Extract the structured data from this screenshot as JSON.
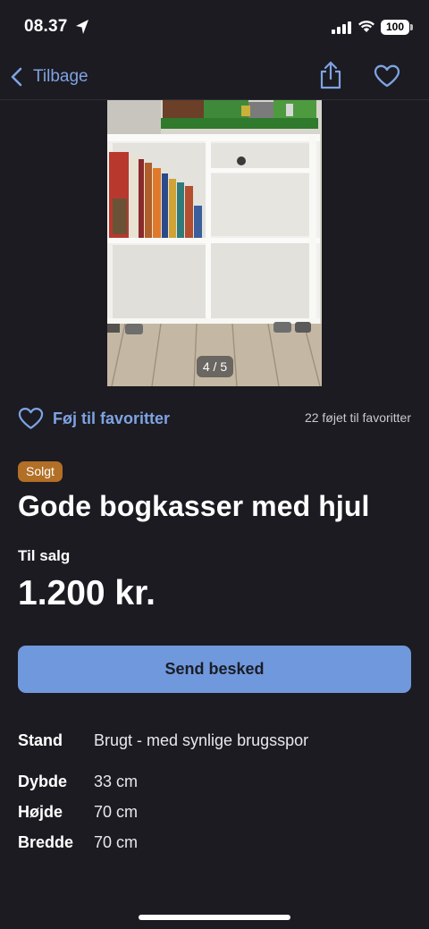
{
  "status_bar": {
    "time": "08.37",
    "battery": "100"
  },
  "nav": {
    "back_label": "Tilbage"
  },
  "photo": {
    "counter": "4 / 5"
  },
  "favorites": {
    "add_label": "Føj til favoritter",
    "count_text": "22 føjet til favoritter"
  },
  "listing": {
    "status_badge": "Solgt",
    "title": "Gode bogkasser med hjul",
    "sale_type": "Til salg",
    "price": "1.200 kr."
  },
  "actions": {
    "send_label": "Send besked"
  },
  "details": [
    {
      "label": "Stand",
      "value": "Brugt - med synlige brugsspor"
    },
    {
      "label": "Dybde",
      "value": "33 cm"
    },
    {
      "label": "Højde",
      "value": "70 cm"
    },
    {
      "label": "Bredde",
      "value": "70 cm"
    }
  ],
  "colors": {
    "background": "#1c1b21",
    "accent": "#7ea3e3",
    "button": "#7098dc",
    "sold_badge": "#b26f26"
  },
  "icons": [
    "location-arrow-icon",
    "signal-icon",
    "wifi-icon",
    "battery-icon",
    "chevron-left-icon",
    "share-icon",
    "heart-outline-icon"
  ]
}
